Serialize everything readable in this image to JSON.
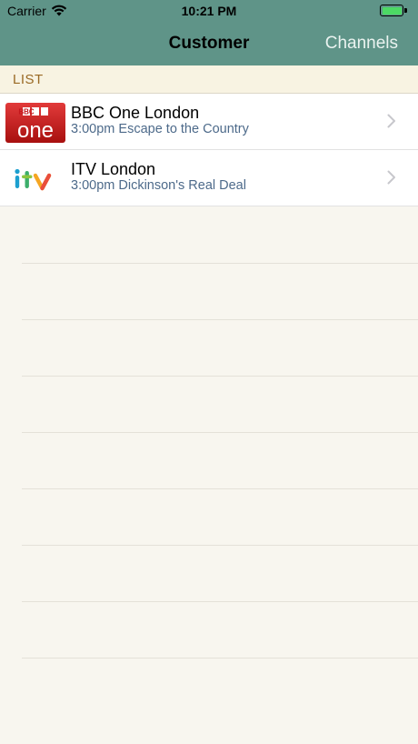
{
  "status_bar": {
    "carrier": "Carrier",
    "time": "10:21 PM",
    "battery_level": 1.0
  },
  "nav": {
    "title": "Customer",
    "right_button": "Channels",
    "background_color": "#5f9488"
  },
  "section": {
    "label": "LIST"
  },
  "channels": [
    {
      "name": "BBC One London",
      "program": "3:00pm Escape to the Country",
      "logo_icon": "bbc-one-logo",
      "logo_text_top": "BBC",
      "logo_text_main": "one"
    },
    {
      "name": "ITV London",
      "program": "3:00pm Dickinson's Real Deal",
      "logo_icon": "itv-logo",
      "logo_text_main": "itv"
    }
  ]
}
